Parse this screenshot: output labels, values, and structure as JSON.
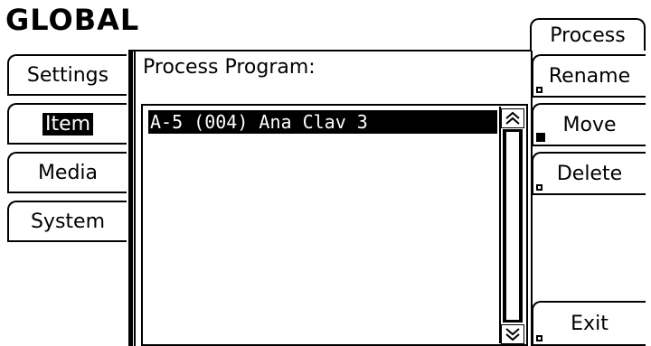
{
  "header": {
    "title": "GLOBAL"
  },
  "left_tabs": [
    {
      "label": "Settings",
      "selected": false
    },
    {
      "label": "Item",
      "selected": true
    },
    {
      "label": "Media",
      "selected": false
    },
    {
      "label": "System",
      "selected": false
    }
  ],
  "panel": {
    "label": "Process Program:",
    "items": [
      "A-5 (004) Ana Clav 3"
    ]
  },
  "scrollbar": {
    "up_icon": "double-up-arrow",
    "down_icon": "double-down-arrow"
  },
  "right_tab": {
    "label": "Process"
  },
  "right_buttons": {
    "rename": "Rename",
    "move": "Move",
    "delete": "Delete",
    "exit": "Exit"
  }
}
